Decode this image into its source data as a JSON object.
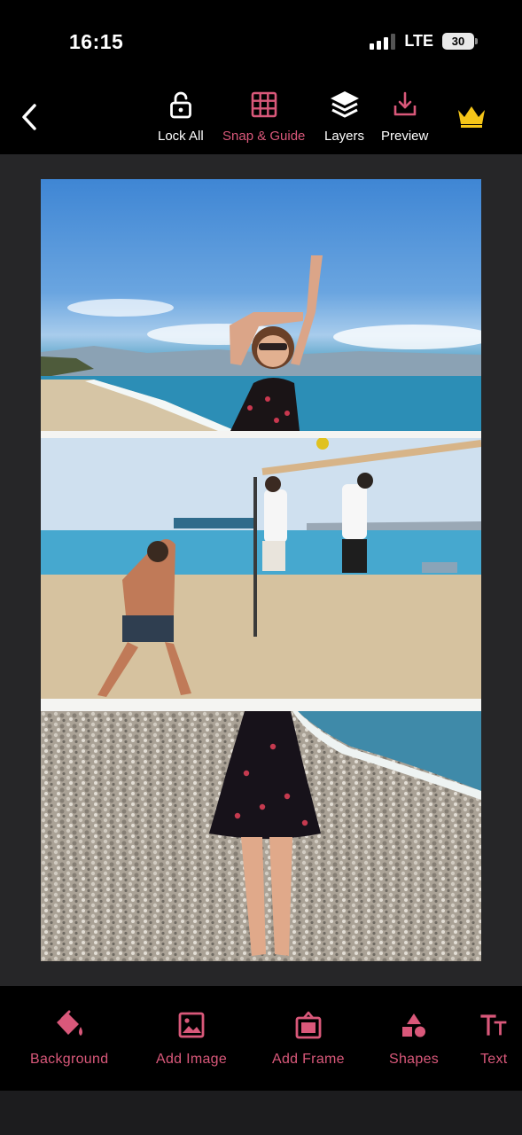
{
  "status": {
    "time": "16:15",
    "network": "LTE",
    "battery": "30"
  },
  "toolbar": {
    "back_icon": "chevron-left-icon",
    "items": [
      {
        "label": "Lock All",
        "icon": "unlock-icon",
        "active": false
      },
      {
        "label": "Snap & Guide",
        "icon": "grid-icon",
        "active": true
      },
      {
        "label": "Layers",
        "icon": "layers-icon",
        "active": false
      },
      {
        "label": "Preview",
        "icon": "download-icon",
        "active": false
      }
    ],
    "premium_icon": "crown-icon"
  },
  "canvas": {
    "photos": [
      {
        "name": "woman-beach-arms-raised"
      },
      {
        "name": "beach-volleyball"
      },
      {
        "name": "woman-dress-pebble-beach"
      }
    ]
  },
  "bottom_toolbar": {
    "items": [
      {
        "label": "Background",
        "icon": "paint-bucket-icon"
      },
      {
        "label": "Add Image",
        "icon": "image-icon"
      },
      {
        "label": "Add Frame",
        "icon": "frame-icon"
      },
      {
        "label": "Shapes",
        "icon": "shapes-icon"
      },
      {
        "label": "Text",
        "icon": "text-icon"
      }
    ]
  },
  "colors": {
    "accent": "#d9587a",
    "crown": "#f5c518",
    "canvas_bg": "#262628"
  }
}
